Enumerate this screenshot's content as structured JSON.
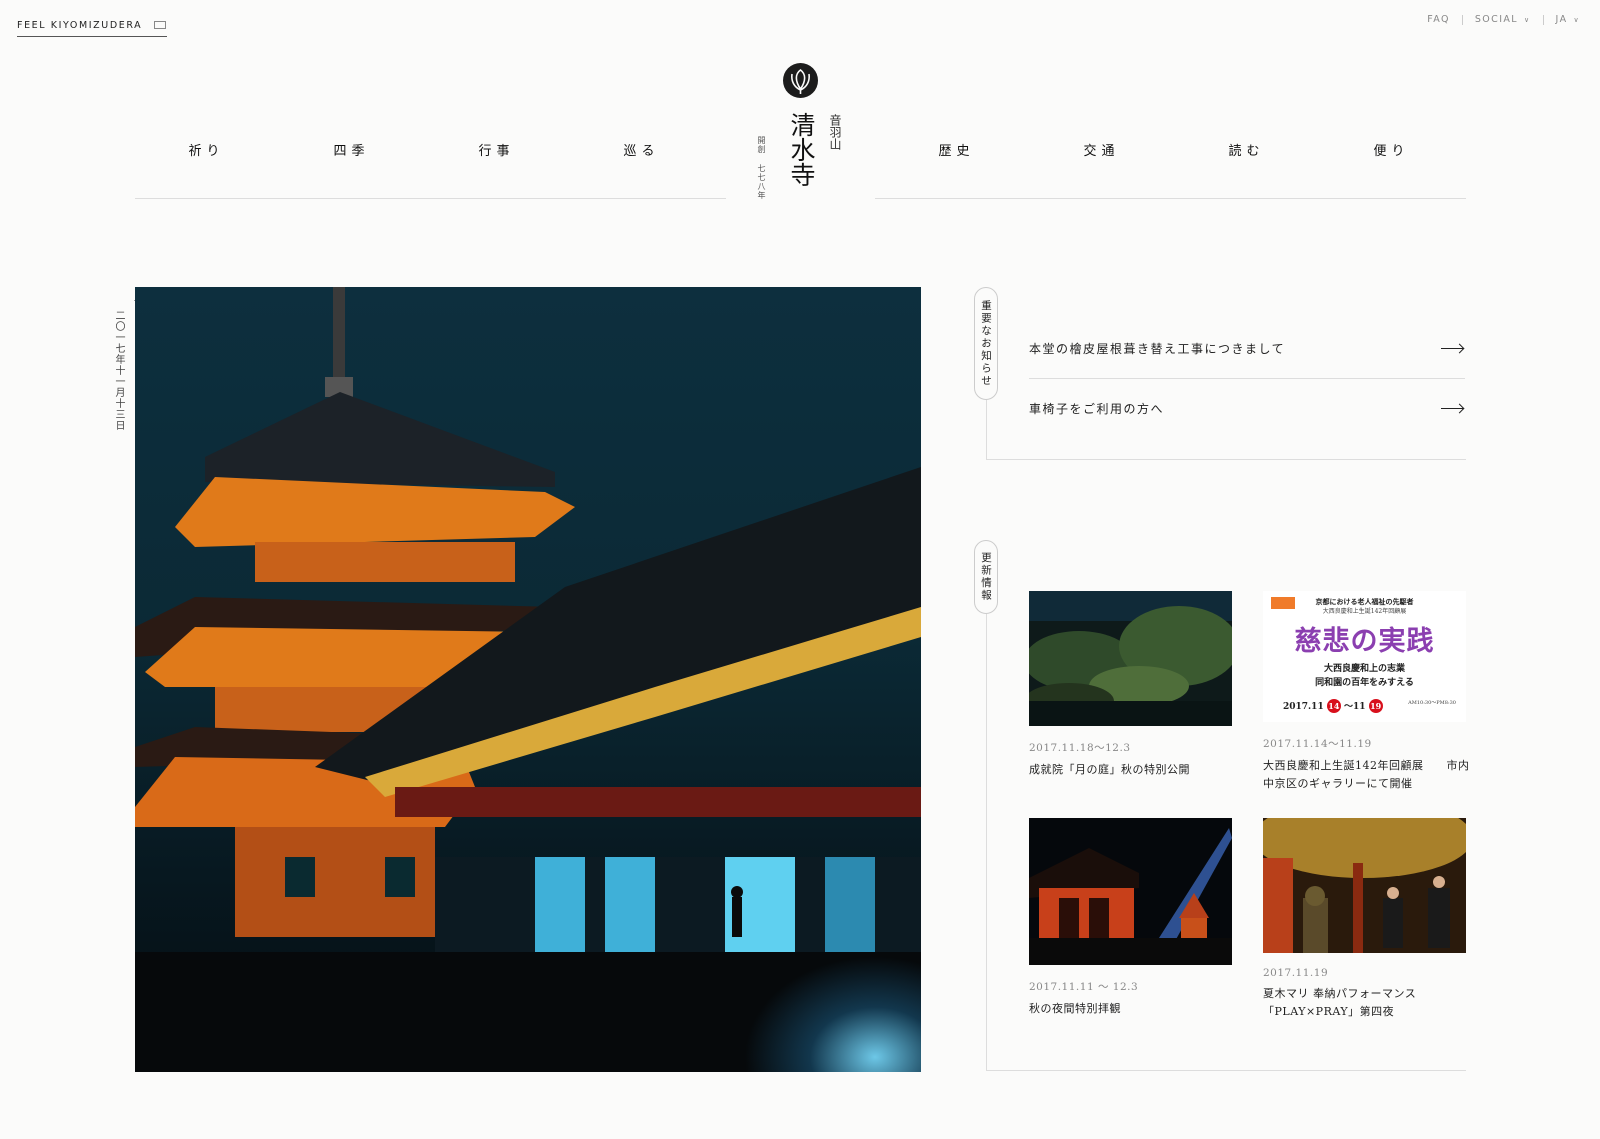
{
  "topbar": {
    "brand": "FEEL KIYOMIZUDERA",
    "faq": "FAQ",
    "social": "SOCIAL",
    "lang": "JA",
    "chevron": "∨"
  },
  "logo": {
    "name": "清水寺",
    "mountain": "音羽山",
    "founded": "開創 七七八年"
  },
  "nav": {
    "left": [
      "祈り",
      "四季",
      "行事",
      "巡る"
    ],
    "right": [
      "歴史",
      "交通",
      "読む",
      "便り"
    ]
  },
  "hero": {
    "date": "二〇一七年十一月十三日"
  },
  "notices": {
    "tag": "重要なお知らせ",
    "items": [
      "本堂の檜皮屋根葺き替え工事につきまして",
      "車椅子をご利用の方へ"
    ]
  },
  "updates": {
    "tag": "更新情報",
    "items": [
      {
        "date": "2017.11.18～12.3",
        "title": "成就院「月の庭」秋の特別公開"
      },
      {
        "date": "2017.11.14～11.19",
        "title": "大西良慶和上生誕142年回顧展　　市内中京区のギャラリーにて開催"
      },
      {
        "date": "2017.11.11 ～ 12.3",
        "title": "秋の夜間特別拝観"
      },
      {
        "date": "2017.11.19",
        "title": "夏木マリ 奉納パフォーマンス「PLAY×PRAY」第四夜"
      }
    ],
    "poster": {
      "line1": "京都における老人福祉の先駆者",
      "line2": "大西良慶和上生誕142年回顧展",
      "headline": "慈悲の実践",
      "line3": "大西良慶和上の志業",
      "line4": "同和園の百年をみすえる",
      "date_prefix": "2017.11",
      "day1": "14",
      "mid": "～11",
      "day2": "19",
      "time": "AM10:30～PM8:30"
    }
  },
  "colors": {
    "background": "#fbfbfa",
    "text": "#222222",
    "rule": "#dddddd",
    "accent_purple": "#8b3fb0",
    "accent_red": "#d8101c"
  }
}
